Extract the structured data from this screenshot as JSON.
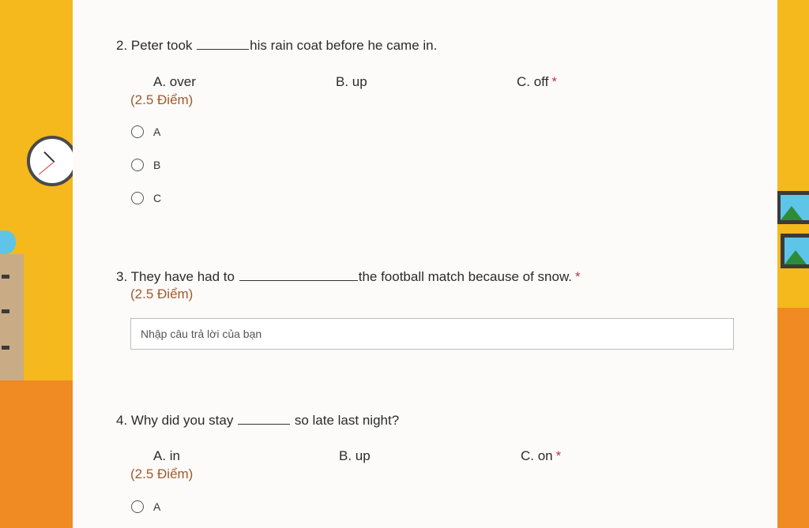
{
  "questions": [
    {
      "number": "2.",
      "before_blank": "Peter took",
      "after_blank": "his rain coat before he came in.",
      "options_text": [
        "A. over",
        "B. up",
        "C. off"
      ],
      "required_mark": "*",
      "points": "(2.5 Điểm)",
      "choices": [
        "A",
        "B",
        "C"
      ],
      "selected": null
    },
    {
      "number": "3.",
      "before_blank": "They have had to",
      "after_blank": "the football match because of snow.",
      "required_mark": "*",
      "points": "(2.5 Điểm)",
      "answer_placeholder": "Nhập câu trả lời của bạn",
      "answer_value": ""
    },
    {
      "number": "4.",
      "before_blank": "Why did you stay",
      "after_blank": "so late last night?",
      "options_text": [
        "A. in",
        "B. up",
        "C. on"
      ],
      "required_mark": "*",
      "points": "(2.5 Điểm)",
      "choices": [
        "A"
      ],
      "selected": null
    }
  ],
  "colors": {
    "accent_required": "#c4314b",
    "points": "#a05a2c",
    "wall": "#f5b81d",
    "floor": "#f08a22",
    "panel": "#fcfbfa"
  },
  "icons": [
    "clock-icon",
    "picture-frame-icon",
    "radio-button-icon"
  ]
}
